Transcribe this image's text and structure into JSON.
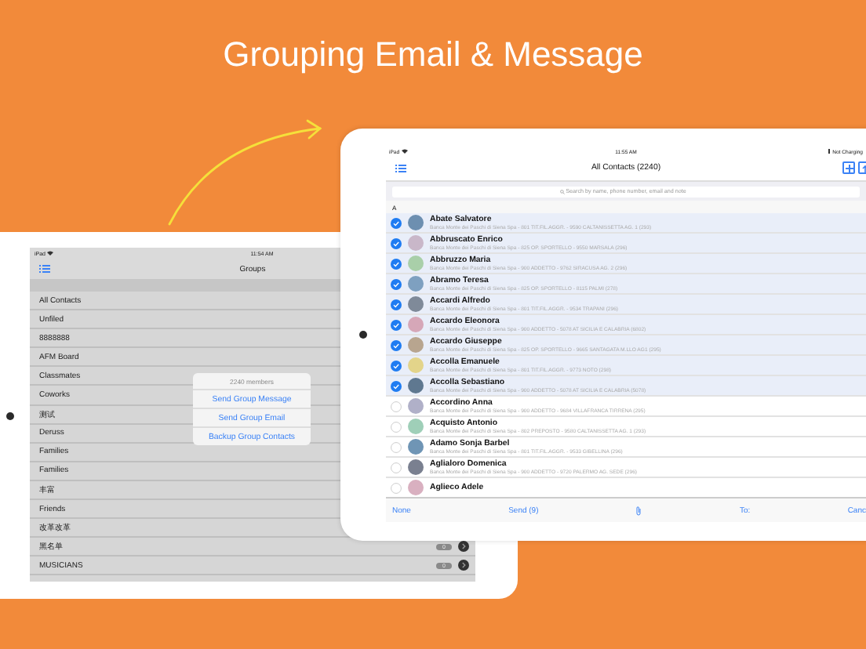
{
  "headline": "Grouping Email & Message",
  "groups_screen": {
    "status_bar": {
      "carrier": "iPad",
      "time": "11:54 AM"
    },
    "title": "Groups",
    "groups": [
      {
        "name": "All Contacts"
      },
      {
        "name": "Unfiled"
      },
      {
        "name": "8888888"
      },
      {
        "name": "AFM Board"
      },
      {
        "name": "Classmates"
      },
      {
        "name": "Coworks"
      },
      {
        "name": "测试"
      },
      {
        "name": "Deruss"
      },
      {
        "name": "Families"
      },
      {
        "name": "Families"
      },
      {
        "name": "丰富"
      },
      {
        "name": "Friends"
      },
      {
        "name": "改革改革"
      },
      {
        "name": "黑名单",
        "badge": "0"
      },
      {
        "name": "MUSICIANS",
        "badge": "0"
      }
    ],
    "popup": {
      "subtitle": "2240 members",
      "actions": [
        "Send Group Message",
        "Send Group Email",
        "Backup Group Contacts"
      ]
    }
  },
  "contacts_screen": {
    "status_bar": {
      "carrier": "iPad",
      "time": "11:55 AM",
      "battery": "Not Charging"
    },
    "title": "All Contacts (2240)",
    "search": {
      "placeholder": "Search by name, phone number, email and note"
    },
    "section": "A",
    "contacts": [
      {
        "name": "Abate Salvatore",
        "detail": "Banca Monte dei Paschi di Siena Spa - 801 TIT.FIL.AGGR. - 9590 CALTANISSETTA AG. 1 (293)",
        "selected": true
      },
      {
        "name": "Abbruscato Enrico",
        "detail": "Banca Monte dei Paschi di Siena Spa - 825 OP. SPORTELLO - 9550 MARSALA (296)",
        "selected": true
      },
      {
        "name": "Abbruzzo Maria",
        "detail": "Banca Monte dei Paschi di Siena Spa - 900 ADDETTO - 9762 SIRACUSA AG. 2 (296)",
        "selected": true
      },
      {
        "name": "Abramo Teresa",
        "detail": "Banca Monte dei Paschi di Siena Spa - 825 OP. SPORTELLO - 8115 PALMI (278)",
        "selected": true
      },
      {
        "name": "Accardi Alfredo",
        "detail": "Banca Monte dei Paschi di Siena Spa - 801 TIT.FIL.AGGR. - 9534 TRAPANI (296)",
        "selected": true
      },
      {
        "name": "Accardo Eleonora",
        "detail": "Banca Monte dei Paschi di Siena Spa - 900 ADDETTO - 5078 AT SICILIA E CALABRIA (6802)",
        "selected": true
      },
      {
        "name": "Accardo Giuseppe",
        "detail": "Banca Monte dei Paschi di Siena Spa - 825 OP. SPORTELLO - 9665 SANTAGATA M.LLO AG1 (295)",
        "selected": true
      },
      {
        "name": "Accolla Emanuele",
        "detail": "Banca Monte dei Paschi di Siena Spa - 801 TIT.FIL.AGGR. - 9773 NOTO (298)",
        "selected": true
      },
      {
        "name": "Accolla Sebastiano",
        "detail": "Banca Monte dei Paschi di Siena Spa - 900 ADDETTO - 5078 AT SICILIA E CALABRIA (5078)",
        "selected": true
      },
      {
        "name": "Accordino Anna",
        "detail": "Banca Monte dei Paschi di Siena Spa - 900 ADDETTO - 9684 VILLAFRANCA TIRRENA (295)",
        "selected": false
      },
      {
        "name": "Acquisto Antonio",
        "detail": "Banca Monte dei Paschi di Siena Spa - 802 PREPOSTO - 9580 CALTANISSETTA AG. 1 (293)",
        "selected": false
      },
      {
        "name": "Adamo Sonja Barbel",
        "detail": "Banca Monte dei Paschi di Siena Spa - 801 TIT.FIL.AGGR. - 9533 GIBELLINA (296)",
        "selected": false
      },
      {
        "name": "Aglialoro Domenica",
        "detail": "Banca Monte dei Paschi di Siena Spa - 900 ADDETTO - 9720 PALERMO AG. SEDE (296)",
        "selected": false
      },
      {
        "name": "Aglieco Adele",
        "selected": false
      }
    ],
    "toolbar": {
      "none": "None",
      "send": "Send (9)",
      "to": "To:",
      "cancel": "Canc"
    }
  }
}
